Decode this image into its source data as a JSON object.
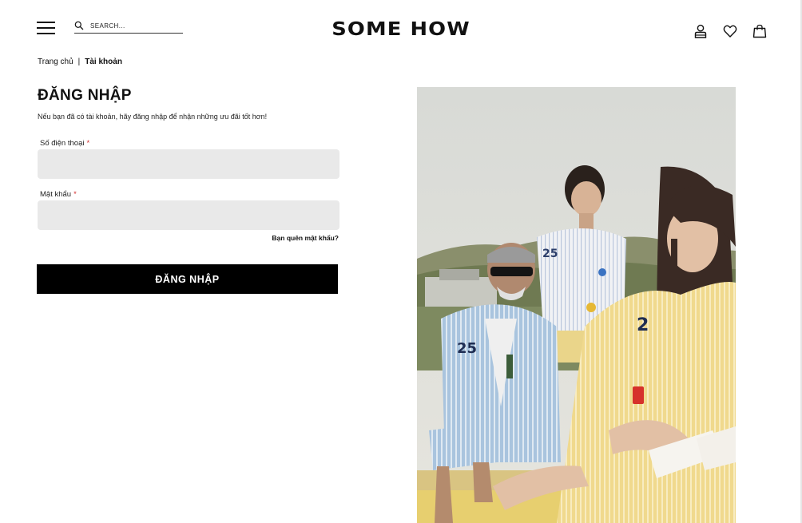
{
  "header": {
    "search": {
      "placeholder": "SEARCH..."
    },
    "logo": "SOME HOW",
    "icons": {
      "menu": "hamburger-menu-icon",
      "search": "search-icon",
      "account": "user-icon",
      "wishlist": "heart-icon",
      "cart": "shopping-bag-icon"
    }
  },
  "breadcrumb": {
    "home": "Trang chủ",
    "separator": "|",
    "current": "Tài khoản"
  },
  "login": {
    "title": "ĐĂNG NHẬP",
    "subtitle": "Nếu bạn đã có tài khoản, hãy đăng nhập để nhận những ưu đãi tốt hơn!",
    "phone_label": "Số điện thoại",
    "password_label": "Mật khẩu",
    "required_mark": "*",
    "phone_value": "",
    "password_value": "",
    "forgot_link": "Bạn quên mật khẩu?",
    "submit_label": "ĐĂNG NHẬP"
  },
  "colors": {
    "primary": "#000000",
    "input_bg": "#e9e9e9",
    "required": "#d32f2f"
  }
}
